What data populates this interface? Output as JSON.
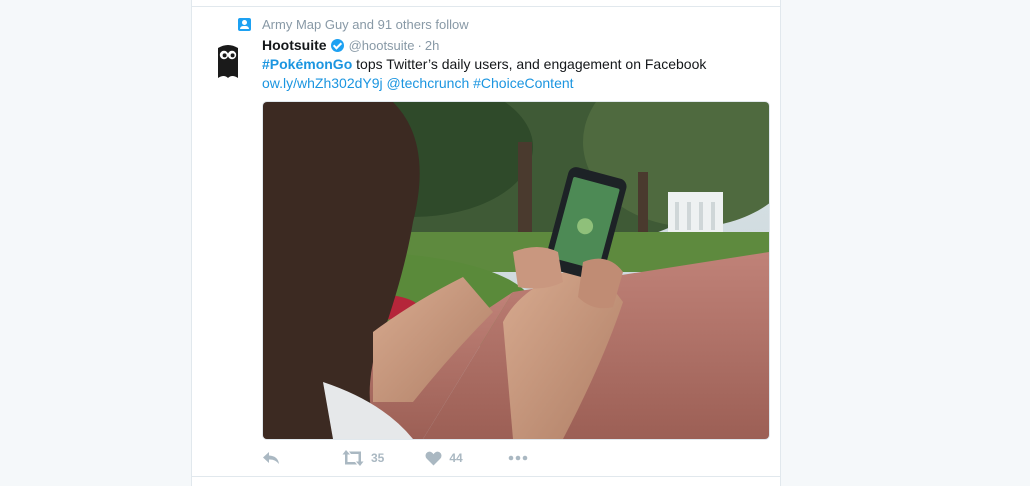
{
  "context": {
    "text": "Army Map Guy and 91 others follow"
  },
  "tweet": {
    "name": "Hootsuite",
    "handle": "@hootsuite",
    "separator": "·",
    "time": "2h",
    "hashtag": "#PokémonGo",
    "text_rest": " tops Twitter’s daily users, and engagement on Facebook",
    "link": "ow.ly/whZh302dY9j",
    "mention": "@techcrunch",
    "hashtag2": "#ChoiceContent",
    "retweet_count": "35",
    "like_count": "44"
  },
  "icons": [
    "person-icon",
    "verified-badge-icon",
    "reply-icon",
    "retweet-icon",
    "heart-icon",
    "more-icon"
  ],
  "colors": {
    "accent": "#1da1f2",
    "link": "#1b95e0",
    "muted": "#8899a6",
    "action": "#aab8c2"
  }
}
